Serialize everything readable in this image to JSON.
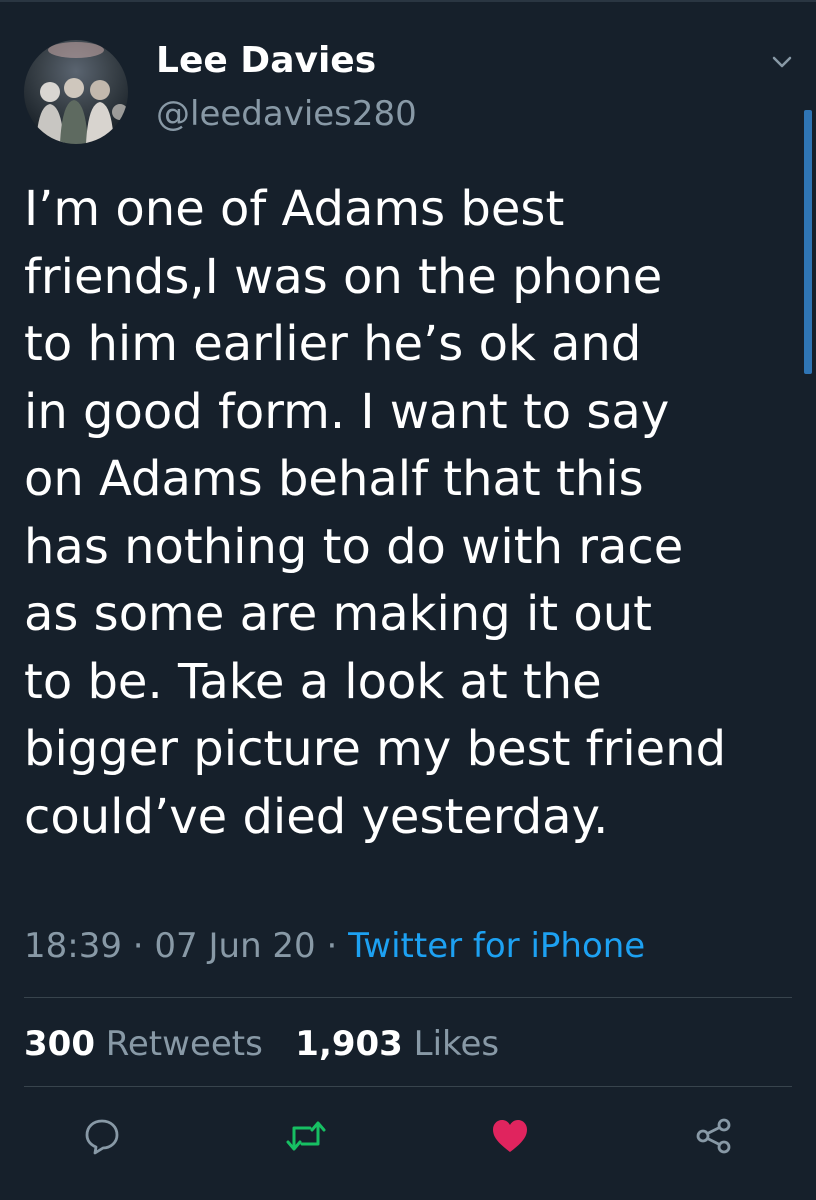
{
  "author": {
    "name": "Lee Davies",
    "handle": "@leedavies280"
  },
  "tweet": {
    "lines": [
      "I’m one of Adams best",
      "friends,I was on the phone",
      "to him earlier he’s ok and",
      "in good form. I want to say",
      "on Adams behalf that this",
      "has nothing to do with race",
      "as some are making it out",
      "to be. Take a look at the",
      "bigger picture my best friend",
      "could’ve died yesterday."
    ],
    "time": "18:39",
    "date": "07 Jun 20",
    "separator": "·",
    "source": "Twitter for iPhone"
  },
  "stats": {
    "retweets_count": "300",
    "retweets_label": "Retweets",
    "likes_count": "1,903",
    "likes_label": "Likes"
  },
  "actions": {
    "reply_icon": "reply-icon",
    "retweet_icon": "retweet-icon",
    "like_icon": "heart-icon",
    "share_icon": "share-icon"
  },
  "colors": {
    "background": "#16202b",
    "accent_blue": "#1da1f2",
    "retweet_green": "#17bf63",
    "like_red": "#e0245e",
    "muted_text": "#8899a6"
  }
}
